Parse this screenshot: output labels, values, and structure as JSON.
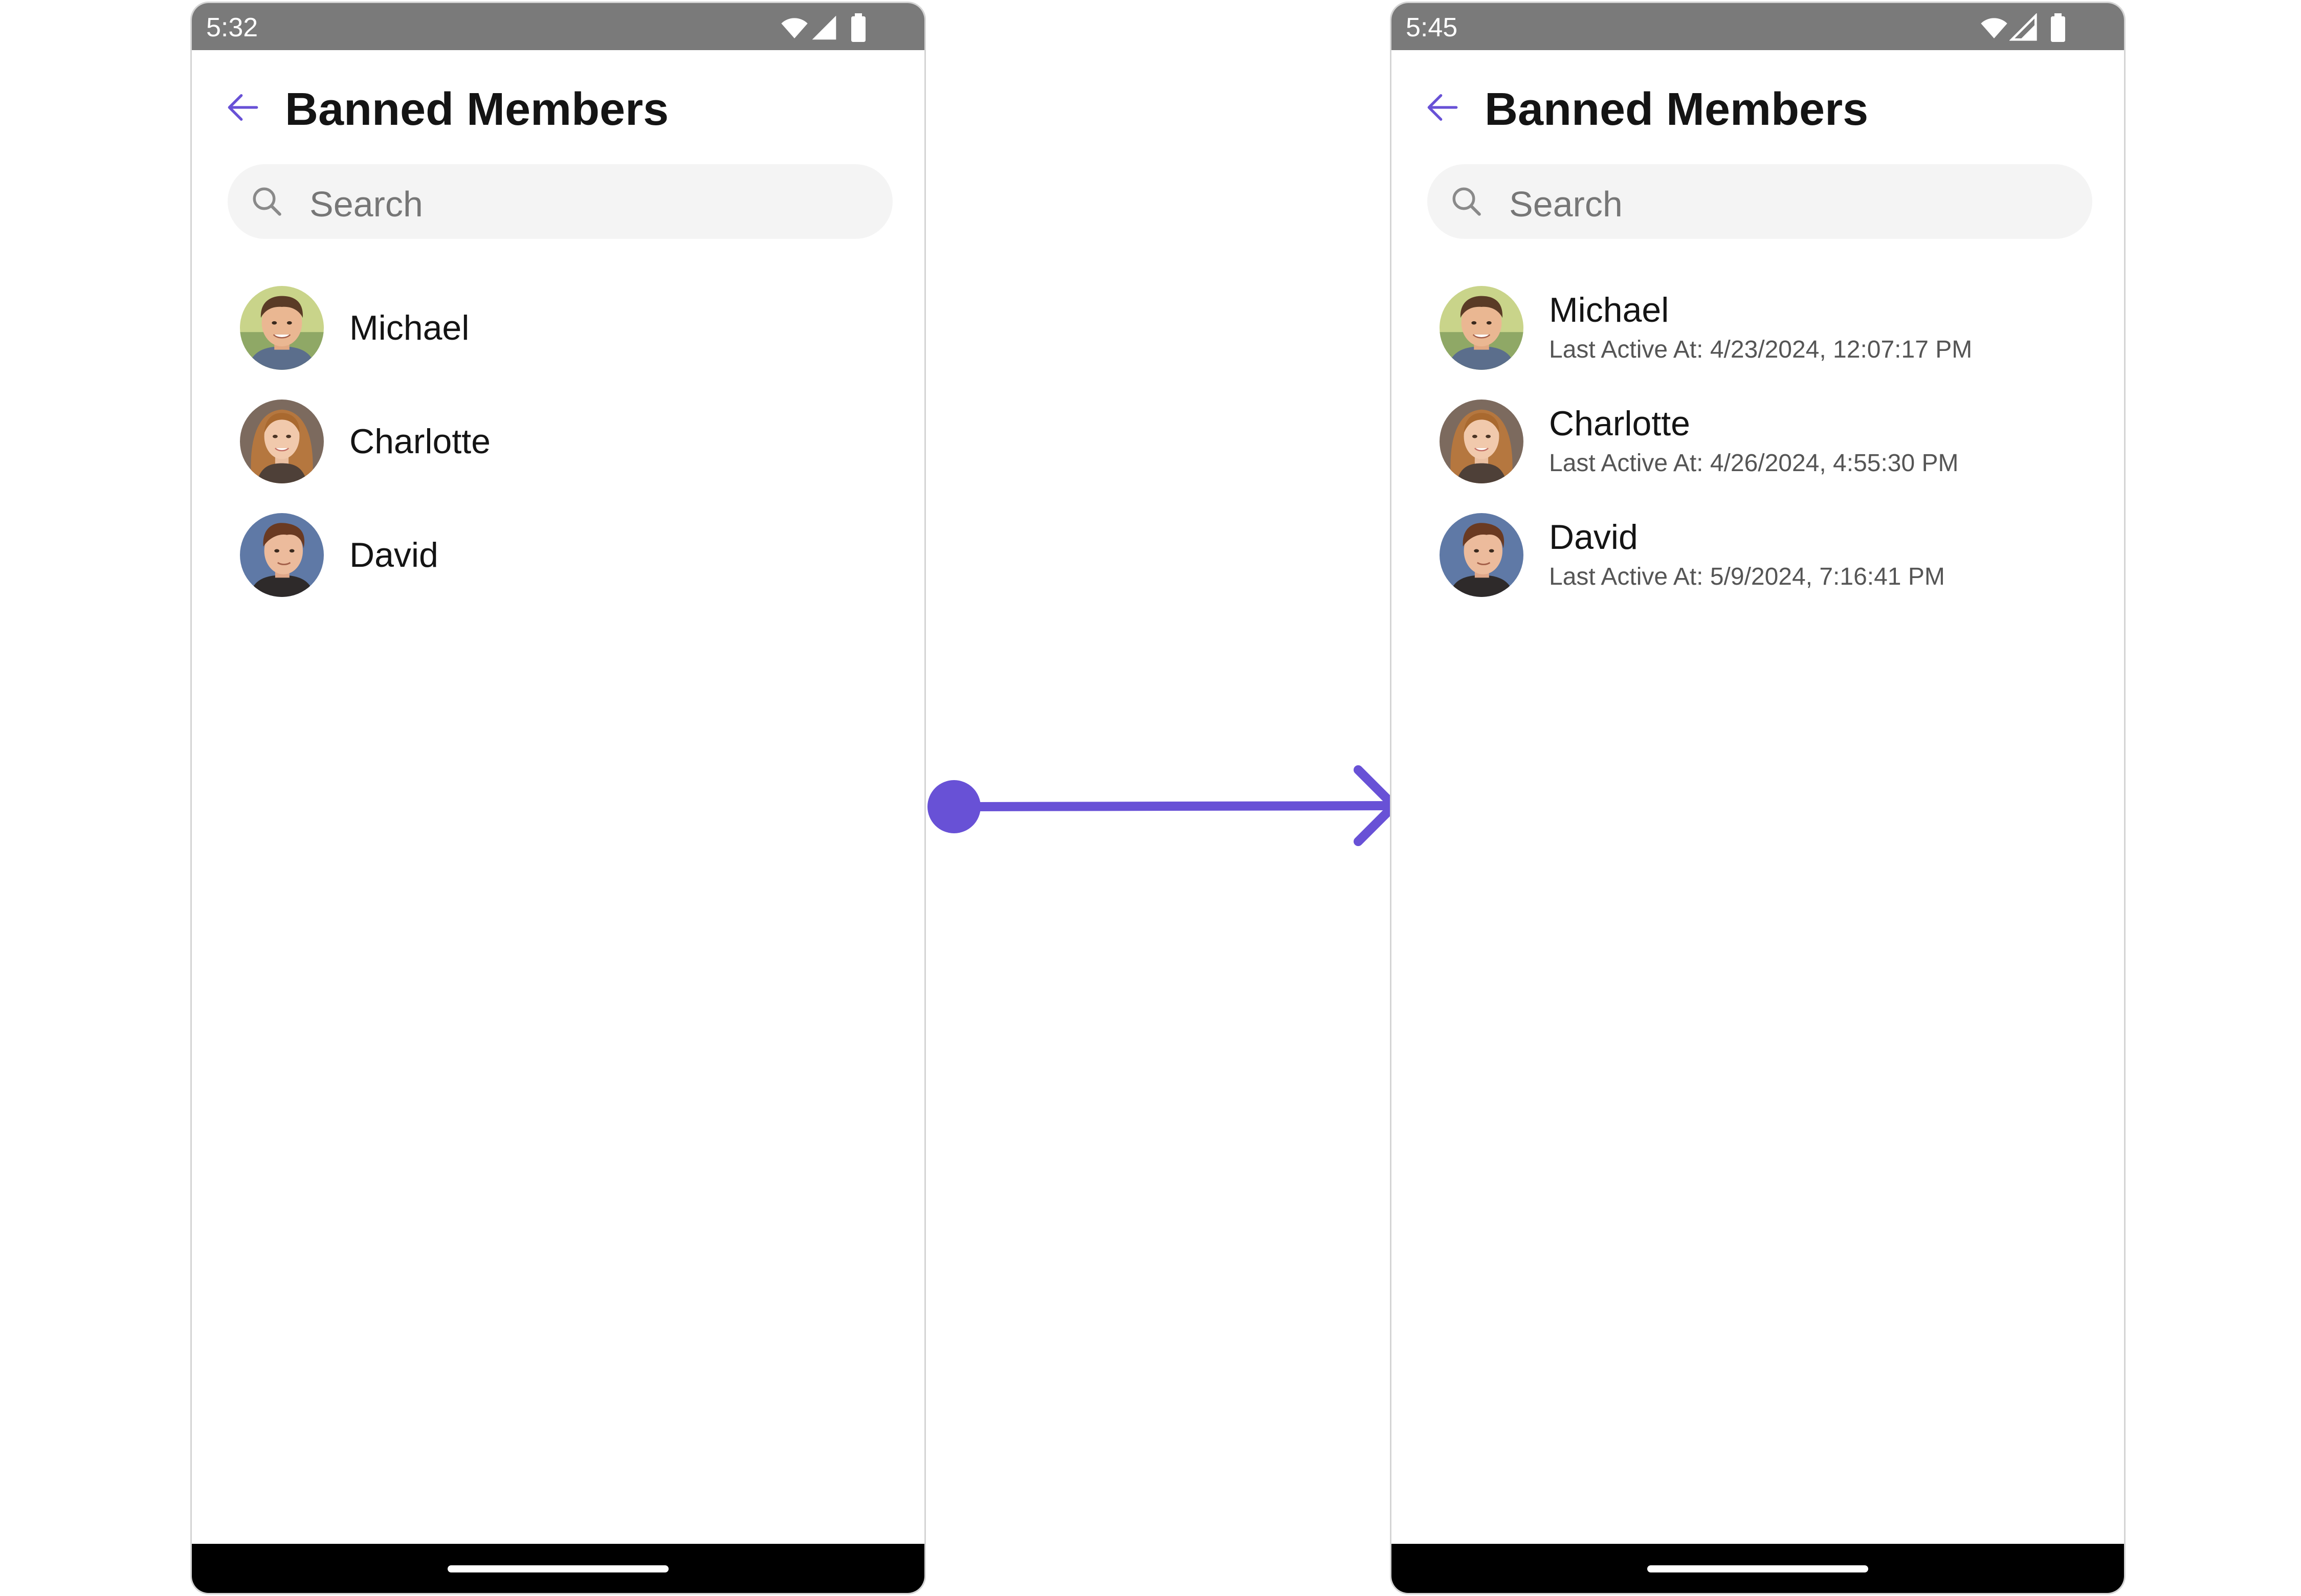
{
  "colors": {
    "accent": "#6851D6",
    "status_bar": "#7A7A7A",
    "search_bg": "#F4F4F4",
    "title_text": "#141414",
    "secondary_text": "#555555"
  },
  "screens": [
    {
      "status_time": "5:32",
      "title": "Banned Members",
      "search_placeholder": "Search",
      "members": [
        {
          "name": "Michael",
          "avatar": "avatar-michael"
        },
        {
          "name": "Charlotte",
          "avatar": "avatar-charlotte"
        },
        {
          "name": "David",
          "avatar": "avatar-david"
        }
      ]
    },
    {
      "status_time": "5:45",
      "title": "Banned Members",
      "search_placeholder": "Search",
      "members": [
        {
          "name": "Michael",
          "last_active": "Last Active At: 4/23/2024, 12:07:17 PM",
          "avatar": "avatar-michael"
        },
        {
          "name": "Charlotte",
          "last_active": "Last Active At: 4/26/2024, 4:55:30 PM",
          "avatar": "avatar-charlotte"
        },
        {
          "name": "David",
          "last_active": "Last Active At: 5/9/2024, 7:16:41 PM",
          "avatar": "avatar-david"
        }
      ]
    }
  ],
  "icons": {
    "back": "arrow-left-icon",
    "search": "search-icon",
    "wifi": "wifi-icon",
    "signal": "signal-icon",
    "battery": "battery-icon",
    "transition": "right-arrow-icon"
  }
}
